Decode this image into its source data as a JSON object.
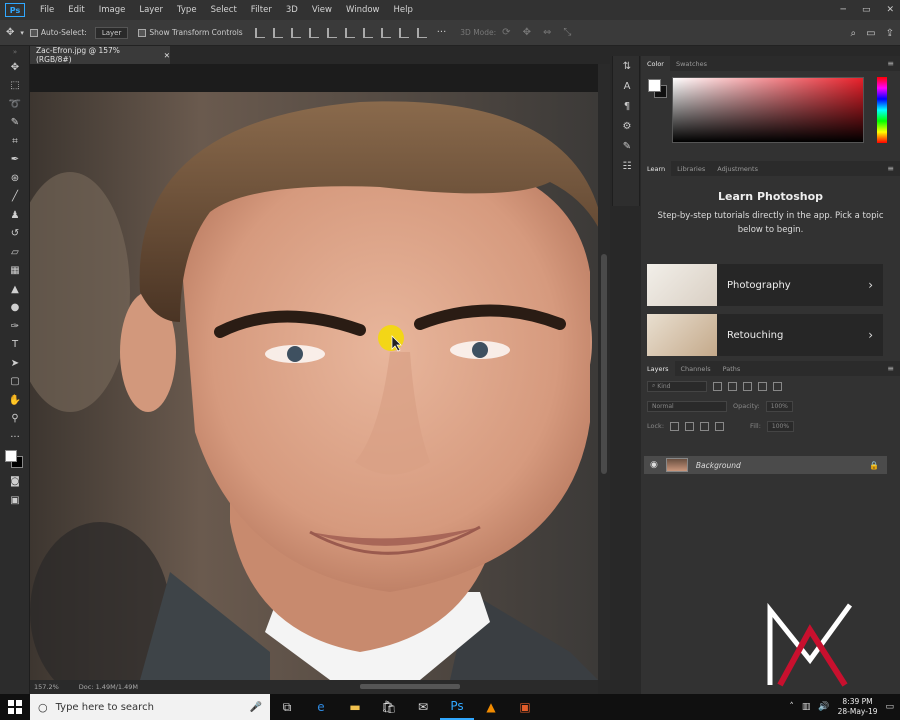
{
  "app": {
    "logo": "Ps"
  },
  "menu": [
    "File",
    "Edit",
    "Image",
    "Layer",
    "Type",
    "Select",
    "Filter",
    "3D",
    "View",
    "Window",
    "Help"
  ],
  "window_controls": {
    "minimize": "─",
    "maximize": "▭",
    "close": "✕"
  },
  "options": {
    "auto_select_label": "Auto-Select:",
    "auto_select_value": "Layer",
    "transform_label": "Show Transform Controls",
    "mode_3d": "3D Mode:"
  },
  "tools": [
    "move",
    "marquee",
    "lasso",
    "quick-select",
    "crop",
    "eyedropper",
    "healing",
    "brush",
    "stamp",
    "history",
    "eraser",
    "gradient",
    "blur",
    "dodge",
    "pen",
    "type",
    "path-select",
    "rectangle",
    "hand",
    "zoom",
    "more"
  ],
  "document": {
    "tab_label": "Zac-Efron.jpg @ 157% (RGB/8#)",
    "zoom": "157.2%",
    "doc_info": "Doc: 1.49M/1.49M"
  },
  "panels": {
    "color_tabs": [
      "Color",
      "Swatches"
    ],
    "learn_tabs": [
      "Learn",
      "Libraries",
      "Adjustments"
    ],
    "learn_title": "Learn Photoshop",
    "learn_desc": "Step-by-step tutorials directly in the app. Pick a topic below to begin.",
    "learn_cards": [
      "Photography",
      "Retouching"
    ],
    "layers_tabs": [
      "Layers",
      "Channels",
      "Paths"
    ],
    "kind_label": "Kind",
    "blend_mode": "Normal",
    "opacity_label": "Opacity:",
    "opacity_value": "100%",
    "lock_label": "Lock:",
    "fill_label": "Fill:",
    "fill_value": "100%",
    "layer_name": "Background"
  },
  "colors": {
    "accent": "#31a8ff",
    "panel": "#323232",
    "background": "#282828",
    "cursor_highlight": "#f5dc00"
  },
  "taskbar": {
    "search_placeholder": "Type here to search",
    "time": "8:39 PM",
    "date": "28-May-19"
  }
}
